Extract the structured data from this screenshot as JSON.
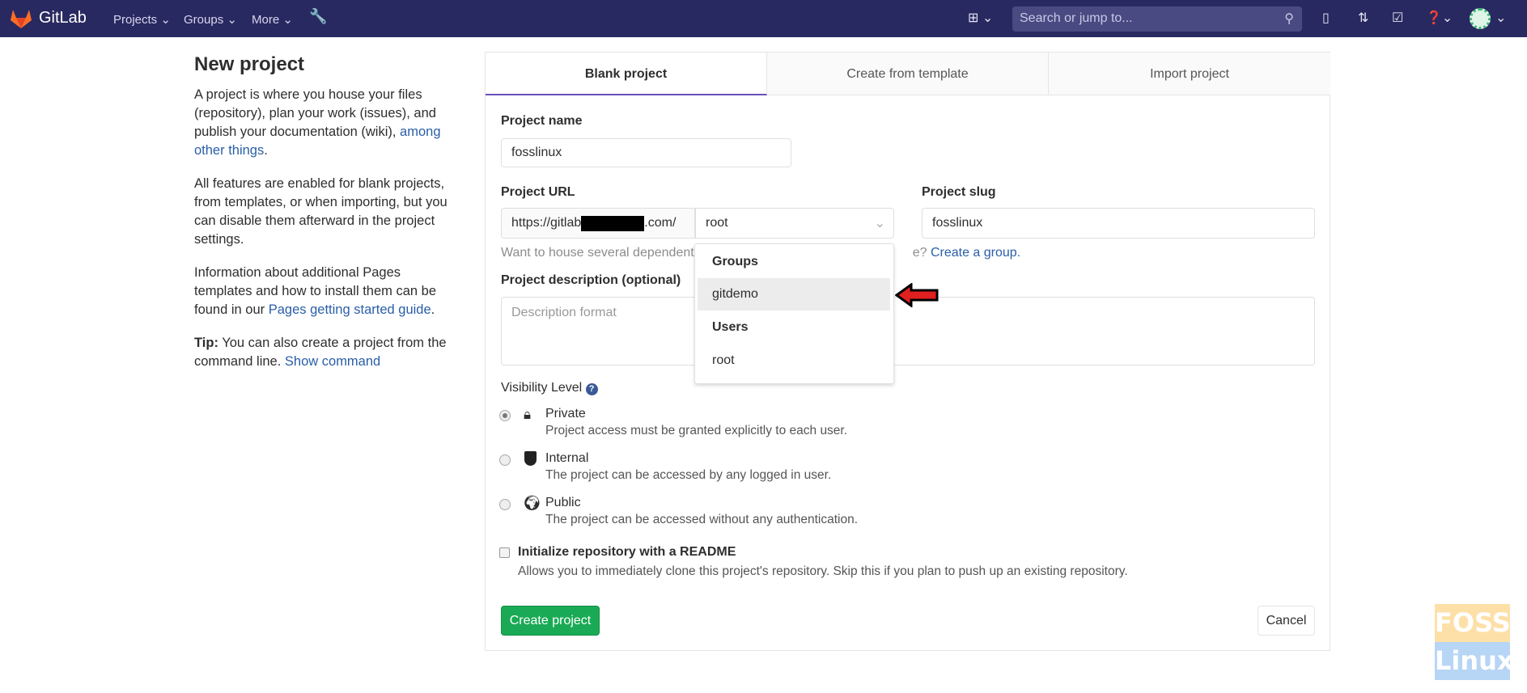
{
  "nav": {
    "brand": "GitLab",
    "projects": "Projects",
    "groups": "Groups",
    "more": "More",
    "search_placeholder": "Search or jump to..."
  },
  "sidebar": {
    "title": "New project",
    "p1": "A project is where you house your files (repository), plan your work (issues), and publish your documentation (wiki),",
    "p1_link": "among other things",
    "p2": "All features are enabled for blank projects, from templates, or when importing, but you can disable them afterward in the project settings.",
    "p3": "Information about additional Pages templates and how to install them can be found in our",
    "p3_link": "Pages getting started guide",
    "tip_label": "Tip:",
    "tip": "You can also create a project from the command line.",
    "tip_link": "Show command"
  },
  "tabs": [
    {
      "label": "Blank project"
    },
    {
      "label": "Create from template"
    },
    {
      "label": "Import project"
    }
  ],
  "form": {
    "name_label": "Project name",
    "name_value": "fosslinux",
    "url_label": "Project URL",
    "url_prefix_a": "https://gitlab",
    "url_prefix_b": ".com/",
    "namespace_value": "root",
    "slug_label": "Project slug",
    "slug_value": "fosslinux",
    "help_text": "Want to house several dependent",
    "help_text_end": "e?",
    "help_link": "Create a group.",
    "desc_label": "Project description (optional)",
    "desc_placeholder": "Description format",
    "visibility_label": "Visibility Level",
    "visibility": [
      {
        "label": "Private",
        "desc": "Project access must be granted explicitly to each user.",
        "selected": true
      },
      {
        "label": "Internal",
        "desc": "The project can be accessed by any logged in user.",
        "selected": false
      },
      {
        "label": "Public",
        "desc": "The project can be accessed without any authentication.",
        "selected": false
      }
    ],
    "readme_label": "Initialize repository with a README",
    "readme_desc": "Allows you to immediately clone this project's repository. Skip this if you plan to push up an existing repository.",
    "readme_checked": false,
    "create": "Create project",
    "cancel": "Cancel"
  },
  "dropdown": {
    "groups_header": "Groups",
    "groups": [
      "gitdemo"
    ],
    "users_header": "Users",
    "users": [
      "root"
    ]
  },
  "watermark": {
    "top": "FOSS",
    "bottom": "Linux"
  },
  "colors": {
    "nav": "#292961",
    "accent": "#6b4fbb",
    "create": "#1aaa55",
    "arrow": "#e0201f"
  }
}
